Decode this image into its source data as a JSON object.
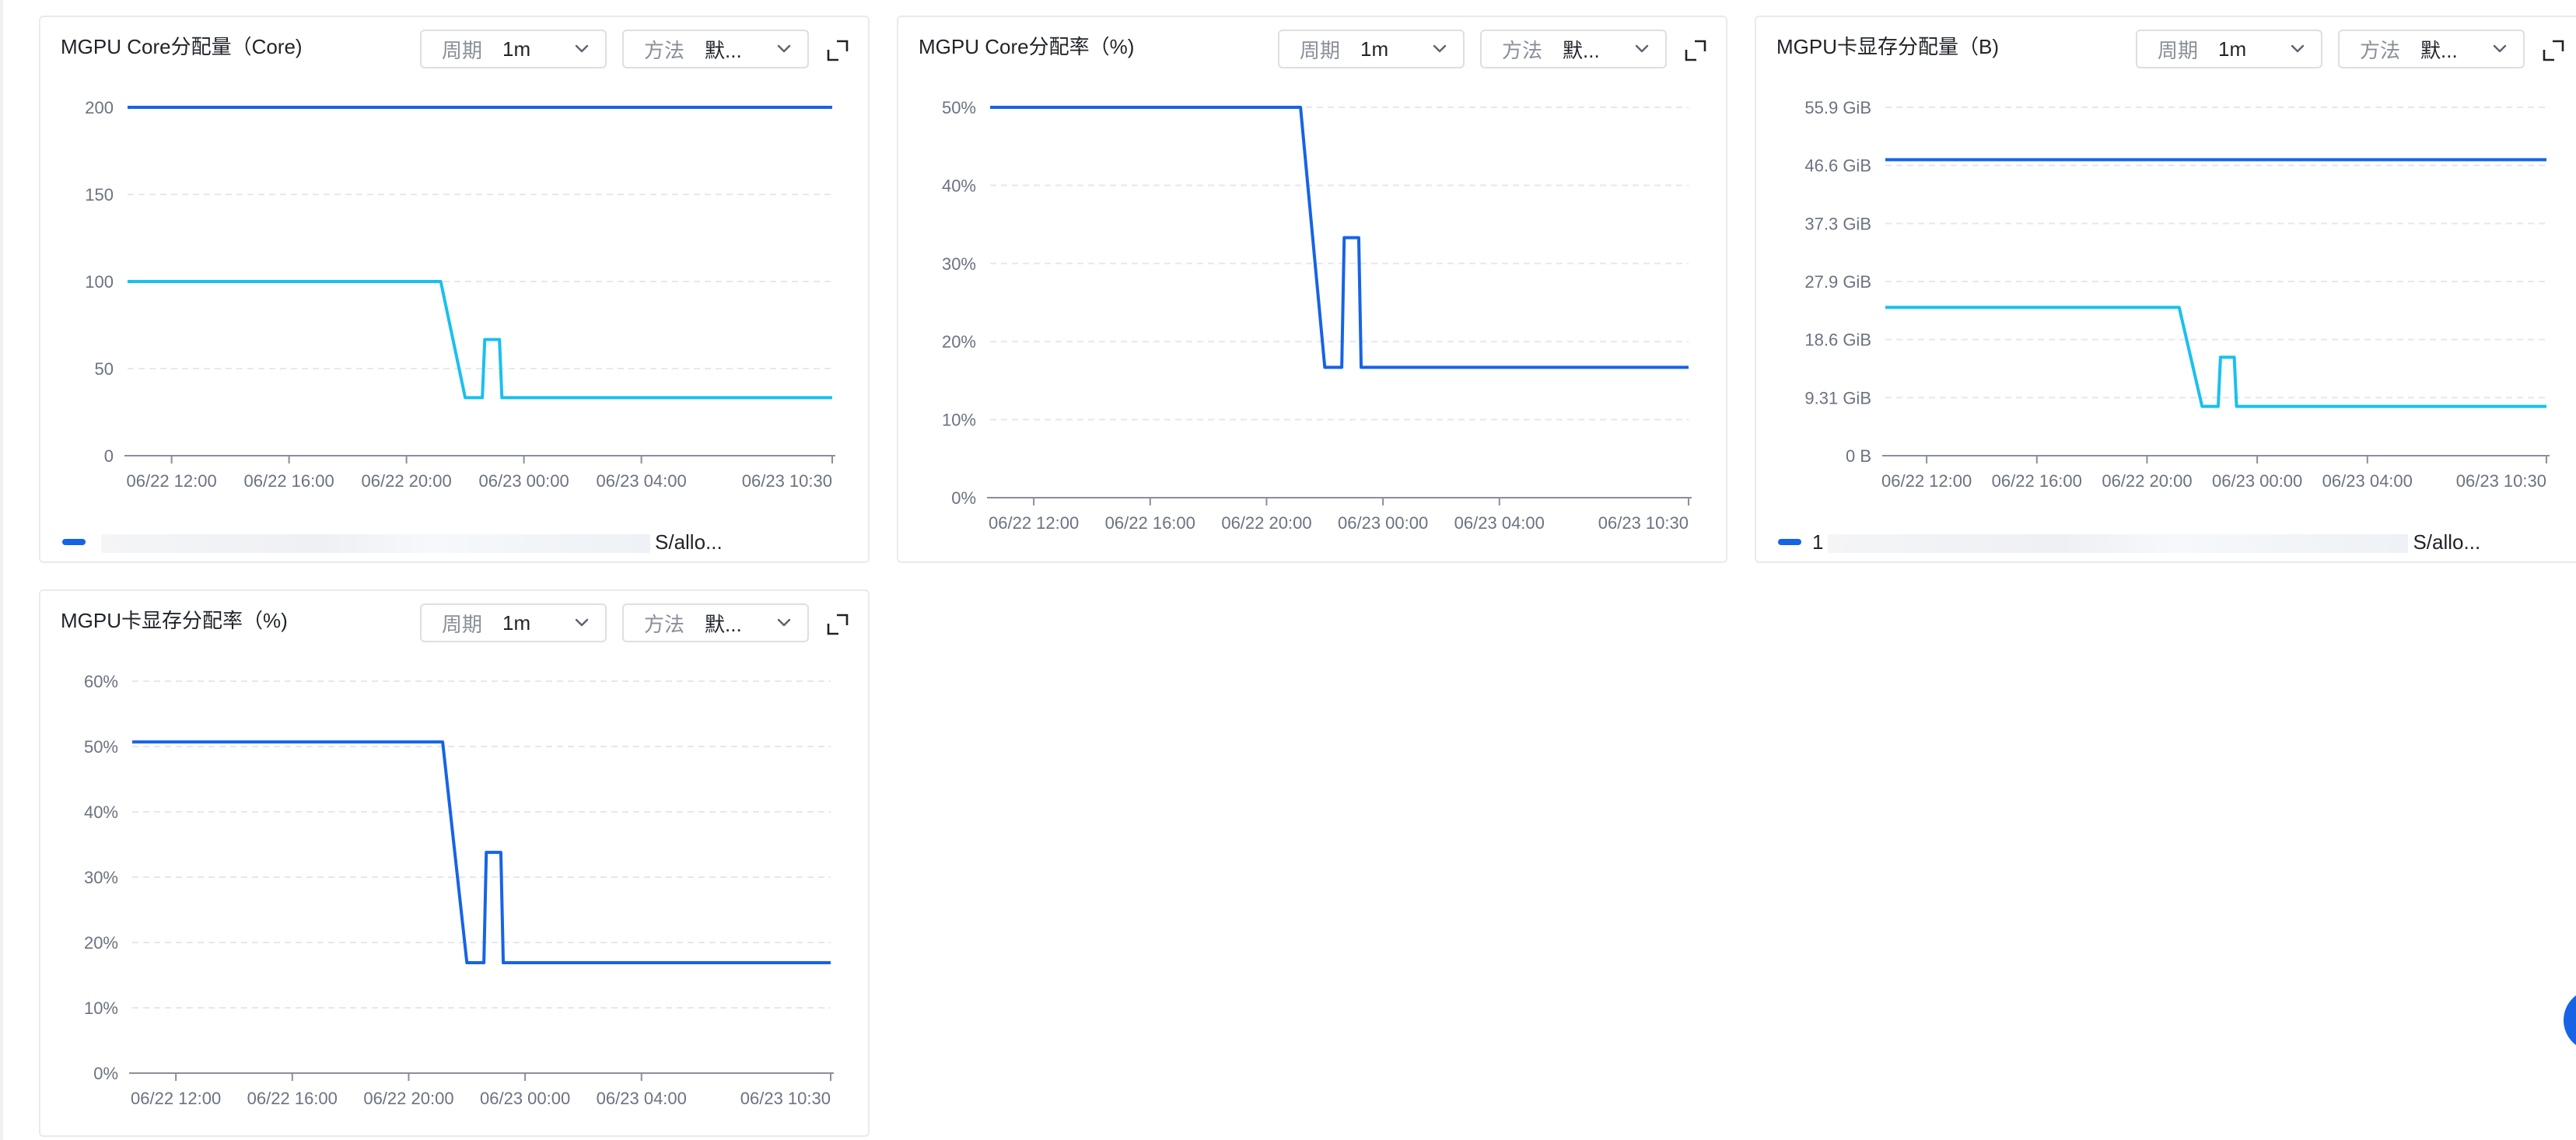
{
  "colors": {
    "primary": "#1664e5",
    "secondary": "#19c0f0",
    "grid": "#e3e8f0",
    "axis": "#8a8f99"
  },
  "panels": [
    {
      "title": "MGPU Core分配量（Core)",
      "period_label": "周期",
      "period_value": "1m",
      "method_label": "方法",
      "method_value": "默...",
      "fullscreen_icon": "expand-icon",
      "legend_prefix": "",
      "legend_suffix": "S/allo...",
      "chart_data": {
        "type": "line",
        "x": [
          "06/22 10:30",
          "06/22 21:10",
          "06/22 22:00",
          "06/22 22:35",
          "06/22 22:40",
          "06/22 23:10",
          "06/22 23:15",
          "06/23 10:30"
        ],
        "xticks": [
          "06/22 12:00",
          "06/22 16:00",
          "06/22 20:00",
          "06/23 00:00",
          "06/23 04:00",
          "06/23 10:30"
        ],
        "yticks": [
          "200",
          "150",
          "100",
          "50",
          "0"
        ],
        "ylim": [
          0,
          200
        ],
        "series": [
          {
            "color": "#1664e5",
            "values": [
              200,
              200,
              200,
              200,
              200,
              200,
              200,
              200
            ]
          },
          {
            "color": "#19c0f0",
            "values": [
              100,
              100,
              33.3,
              33.3,
              66.7,
              66.7,
              33.3,
              33.3
            ]
          }
        ]
      }
    },
    {
      "title": "MGPU Core分配率（%)",
      "period_label": "周期",
      "period_value": "1m",
      "method_label": "方法",
      "method_value": "默...",
      "fullscreen_icon": "expand-icon",
      "chart_data": {
        "type": "line",
        "x": [
          "06/22 10:30",
          "06/22 21:10",
          "06/22 22:00",
          "06/22 22:35",
          "06/22 22:40",
          "06/22 23:10",
          "06/22 23:15",
          "06/23 10:30"
        ],
        "xticks": [
          "06/22 12:00",
          "06/22 16:00",
          "06/22 20:00",
          "06/23 00:00",
          "06/23 04:00",
          "06/23 10:30"
        ],
        "yticks": [
          "50%",
          "40%",
          "30%",
          "20%",
          "10%",
          "0%"
        ],
        "ylim": [
          0,
          50
        ],
        "series": [
          {
            "color": "#1664e5",
            "values": [
              50,
              50,
              16.7,
              16.7,
              33.3,
              33.3,
              16.7,
              16.7
            ]
          }
        ]
      }
    },
    {
      "title": "MGPU卡显存分配量（B)",
      "period_label": "周期",
      "period_value": "1m",
      "method_label": "方法",
      "method_value": "默...",
      "fullscreen_icon": "expand-icon",
      "legend_prefix": "1",
      "legend_suffix": "S/allo...",
      "chart_data": {
        "type": "line",
        "x": [
          "06/22 10:30",
          "06/22 21:10",
          "06/22 22:00",
          "06/22 22:35",
          "06/22 22:40",
          "06/22 23:10",
          "06/22 23:15",
          "06/23 10:30"
        ],
        "xticks": [
          "06/22 12:00",
          "06/22 16:00",
          "06/22 20:00",
          "06/23 00:00",
          "06/23 04:00",
          "06/23 10:30"
        ],
        "yticks": [
          "55.9 GiB",
          "46.6 GiB",
          "37.3 GiB",
          "27.9 GiB",
          "18.6 GiB",
          "9.31 GiB",
          "0 B"
        ],
        "ylim": [
          0,
          55.9
        ],
        "unit": "GiB",
        "series": [
          {
            "color": "#1664e5",
            "values": [
              47.5,
              47.5,
              47.5,
              47.5,
              47.5,
              47.5,
              47.5,
              47.5
            ]
          },
          {
            "color": "#19c0f0",
            "values": [
              23.8,
              23.8,
              7.9,
              7.9,
              15.8,
              15.8,
              7.9,
              7.9
            ]
          }
        ]
      }
    },
    {
      "title": "MGPU卡显存分配率（%)",
      "period_label": "周期",
      "period_value": "1m",
      "method_label": "方法",
      "method_value": "默...",
      "fullscreen_icon": "expand-icon",
      "chart_data": {
        "type": "line",
        "x": [
          "06/22 10:30",
          "06/22 21:10",
          "06/22 22:00",
          "06/22 22:35",
          "06/22 22:40",
          "06/22 23:10",
          "06/22 23:15",
          "06/23 10:30"
        ],
        "xticks": [
          "06/22 12:00",
          "06/22 16:00",
          "06/22 20:00",
          "06/23 00:00",
          "06/23 04:00",
          "06/23 10:30"
        ],
        "yticks": [
          "60%",
          "50%",
          "40%",
          "30%",
          "20%",
          "10%",
          "0%"
        ],
        "ylim": [
          0,
          60
        ],
        "series": [
          {
            "color": "#1664e5",
            "values": [
              50.7,
              50.7,
              16.9,
              16.9,
              33.8,
              33.8,
              16.9,
              16.9
            ]
          }
        ]
      }
    }
  ]
}
